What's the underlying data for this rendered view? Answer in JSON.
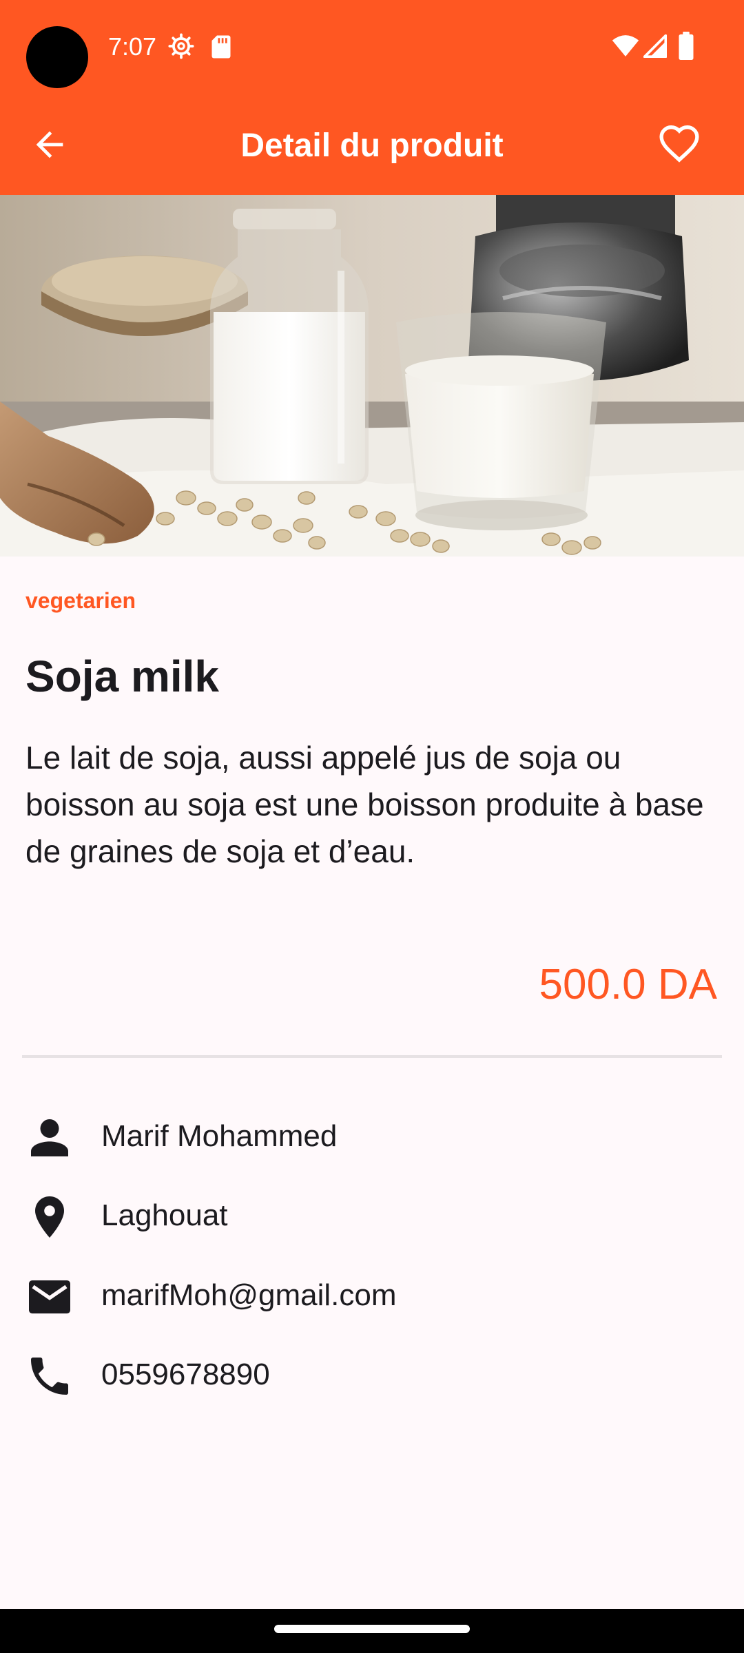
{
  "status_bar": {
    "time": "7:07",
    "icons": [
      "settings-gear-icon",
      "sd-card-icon",
      "wifi-icon",
      "cell-signal-icon",
      "battery-icon"
    ]
  },
  "app_bar": {
    "title": "Detail du produit",
    "back_icon": "arrow-back-icon",
    "favorite_icon": "heart-outline-icon"
  },
  "product": {
    "category": "vegetarien",
    "name": "Soja milk",
    "description": "Le lait de soja, aussi appelé jus de soja ou boisson au soja est une boisson produite à base de graines de soja et d’eau.",
    "price": "500.0 DA"
  },
  "seller": {
    "name": "Marif Mohammed",
    "location": "Laghouat",
    "email": "marifMoh@gmail.com",
    "phone": "0559678890"
  },
  "colors": {
    "primary": "#ff5722",
    "background": "#fff9fb",
    "text": "#1c1b1f"
  }
}
